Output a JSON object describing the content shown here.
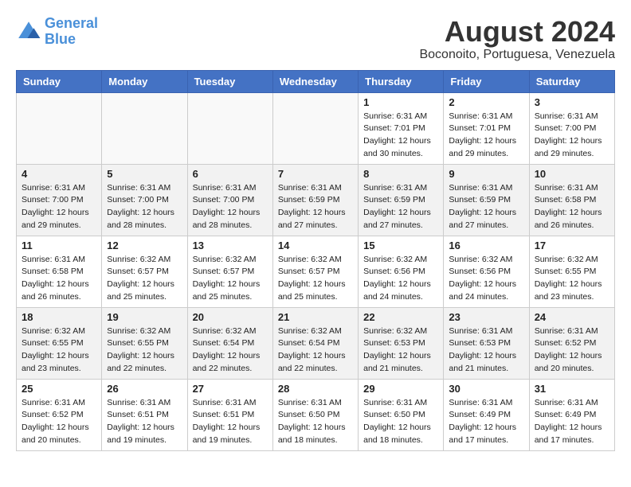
{
  "logo": {
    "line1": "General",
    "line2": "Blue"
  },
  "title": "August 2024",
  "subtitle": "Boconoito, Portuguesa, Venezuela",
  "weekdays": [
    "Sunday",
    "Monday",
    "Tuesday",
    "Wednesday",
    "Thursday",
    "Friday",
    "Saturday"
  ],
  "weeks": [
    [
      {
        "day": "",
        "detail": ""
      },
      {
        "day": "",
        "detail": ""
      },
      {
        "day": "",
        "detail": ""
      },
      {
        "day": "",
        "detail": ""
      },
      {
        "day": "1",
        "detail": "Sunrise: 6:31 AM\nSunset: 7:01 PM\nDaylight: 12 hours\nand 30 minutes."
      },
      {
        "day": "2",
        "detail": "Sunrise: 6:31 AM\nSunset: 7:01 PM\nDaylight: 12 hours\nand 29 minutes."
      },
      {
        "day": "3",
        "detail": "Sunrise: 6:31 AM\nSunset: 7:00 PM\nDaylight: 12 hours\nand 29 minutes."
      }
    ],
    [
      {
        "day": "4",
        "detail": "Sunrise: 6:31 AM\nSunset: 7:00 PM\nDaylight: 12 hours\nand 29 minutes."
      },
      {
        "day": "5",
        "detail": "Sunrise: 6:31 AM\nSunset: 7:00 PM\nDaylight: 12 hours\nand 28 minutes."
      },
      {
        "day": "6",
        "detail": "Sunrise: 6:31 AM\nSunset: 7:00 PM\nDaylight: 12 hours\nand 28 minutes."
      },
      {
        "day": "7",
        "detail": "Sunrise: 6:31 AM\nSunset: 6:59 PM\nDaylight: 12 hours\nand 27 minutes."
      },
      {
        "day": "8",
        "detail": "Sunrise: 6:31 AM\nSunset: 6:59 PM\nDaylight: 12 hours\nand 27 minutes."
      },
      {
        "day": "9",
        "detail": "Sunrise: 6:31 AM\nSunset: 6:59 PM\nDaylight: 12 hours\nand 27 minutes."
      },
      {
        "day": "10",
        "detail": "Sunrise: 6:31 AM\nSunset: 6:58 PM\nDaylight: 12 hours\nand 26 minutes."
      }
    ],
    [
      {
        "day": "11",
        "detail": "Sunrise: 6:31 AM\nSunset: 6:58 PM\nDaylight: 12 hours\nand 26 minutes."
      },
      {
        "day": "12",
        "detail": "Sunrise: 6:32 AM\nSunset: 6:57 PM\nDaylight: 12 hours\nand 25 minutes."
      },
      {
        "day": "13",
        "detail": "Sunrise: 6:32 AM\nSunset: 6:57 PM\nDaylight: 12 hours\nand 25 minutes."
      },
      {
        "day": "14",
        "detail": "Sunrise: 6:32 AM\nSunset: 6:57 PM\nDaylight: 12 hours\nand 25 minutes."
      },
      {
        "day": "15",
        "detail": "Sunrise: 6:32 AM\nSunset: 6:56 PM\nDaylight: 12 hours\nand 24 minutes."
      },
      {
        "day": "16",
        "detail": "Sunrise: 6:32 AM\nSunset: 6:56 PM\nDaylight: 12 hours\nand 24 minutes."
      },
      {
        "day": "17",
        "detail": "Sunrise: 6:32 AM\nSunset: 6:55 PM\nDaylight: 12 hours\nand 23 minutes."
      }
    ],
    [
      {
        "day": "18",
        "detail": "Sunrise: 6:32 AM\nSunset: 6:55 PM\nDaylight: 12 hours\nand 23 minutes."
      },
      {
        "day": "19",
        "detail": "Sunrise: 6:32 AM\nSunset: 6:55 PM\nDaylight: 12 hours\nand 22 minutes."
      },
      {
        "day": "20",
        "detail": "Sunrise: 6:32 AM\nSunset: 6:54 PM\nDaylight: 12 hours\nand 22 minutes."
      },
      {
        "day": "21",
        "detail": "Sunrise: 6:32 AM\nSunset: 6:54 PM\nDaylight: 12 hours\nand 22 minutes."
      },
      {
        "day": "22",
        "detail": "Sunrise: 6:32 AM\nSunset: 6:53 PM\nDaylight: 12 hours\nand 21 minutes."
      },
      {
        "day": "23",
        "detail": "Sunrise: 6:31 AM\nSunset: 6:53 PM\nDaylight: 12 hours\nand 21 minutes."
      },
      {
        "day": "24",
        "detail": "Sunrise: 6:31 AM\nSunset: 6:52 PM\nDaylight: 12 hours\nand 20 minutes."
      }
    ],
    [
      {
        "day": "25",
        "detail": "Sunrise: 6:31 AM\nSunset: 6:52 PM\nDaylight: 12 hours\nand 20 minutes."
      },
      {
        "day": "26",
        "detail": "Sunrise: 6:31 AM\nSunset: 6:51 PM\nDaylight: 12 hours\nand 19 minutes."
      },
      {
        "day": "27",
        "detail": "Sunrise: 6:31 AM\nSunset: 6:51 PM\nDaylight: 12 hours\nand 19 minutes."
      },
      {
        "day": "28",
        "detail": "Sunrise: 6:31 AM\nSunset: 6:50 PM\nDaylight: 12 hours\nand 18 minutes."
      },
      {
        "day": "29",
        "detail": "Sunrise: 6:31 AM\nSunset: 6:50 PM\nDaylight: 12 hours\nand 18 minutes."
      },
      {
        "day": "30",
        "detail": "Sunrise: 6:31 AM\nSunset: 6:49 PM\nDaylight: 12 hours\nand 17 minutes."
      },
      {
        "day": "31",
        "detail": "Sunrise: 6:31 AM\nSunset: 6:49 PM\nDaylight: 12 hours\nand 17 minutes."
      }
    ]
  ]
}
